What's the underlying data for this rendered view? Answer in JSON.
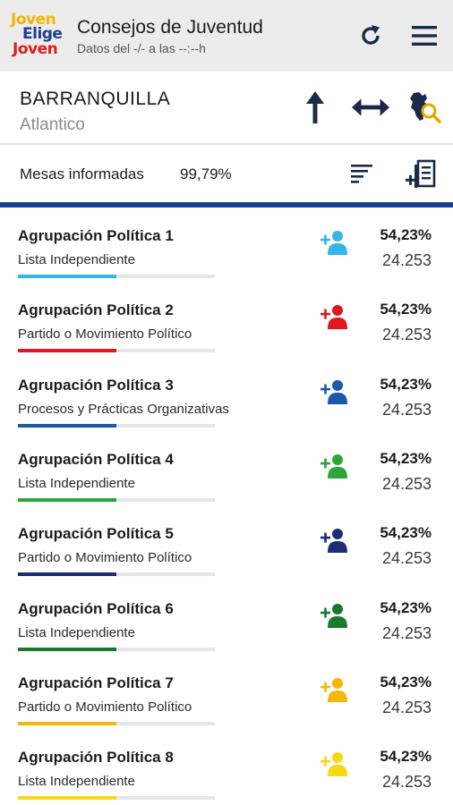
{
  "header": {
    "logo": {
      "line1": "Joven",
      "line2": "Elige",
      "line3": "Joven"
    },
    "title": "Consejos de Juventud",
    "subtitle": "Datos del -/- a las --:--h",
    "icons": [
      "refresh-icon",
      "hamburger-menu-icon"
    ]
  },
  "location": {
    "city": "BARRANQUILLA",
    "department": "Atlantico",
    "icons": [
      "arrow-up-icon",
      "horizontal-arrows-icon",
      "map-search-icon"
    ]
  },
  "stats": {
    "label": "Mesas informadas",
    "value": "99,79%",
    "icons": [
      "sort-lines-icon",
      "add-list-icon"
    ]
  },
  "colors": {
    "accent": "#1b3f93",
    "header_bg": "#ececec"
  },
  "results": [
    {
      "party": "Agrupación Política 1",
      "list_type": "Lista Independiente",
      "percent": "54,23%",
      "votes": "24.253",
      "color": "#35b6ea",
      "bar_fraction": 0.5
    },
    {
      "party": "Agrupación Política 2",
      "list_type": "Partido o Movimiento Político",
      "percent": "54,23%",
      "votes": "24.253",
      "color": "#e2171b",
      "bar_fraction": 0.5
    },
    {
      "party": "Agrupación Política 3",
      "list_type": "Procesos y Prácticas Organizativas",
      "percent": "54,23%",
      "votes": "24.253",
      "color": "#1c59a8",
      "bar_fraction": 0.5
    },
    {
      "party": "Agrupación Política 4",
      "list_type": "Lista Independiente",
      "percent": "54,23%",
      "votes": "24.253",
      "color": "#2ea538",
      "bar_fraction": 0.5
    },
    {
      "party": "Agrupación Política 5",
      "list_type": "Partido o Movimiento Político",
      "percent": "54,23%",
      "votes": "24.253",
      "color": "#1b2c78",
      "bar_fraction": 0.5
    },
    {
      "party": "Agrupación Política 6",
      "list_type": "Lista Independiente",
      "percent": "54,23%",
      "votes": "24.253",
      "color": "#187a31",
      "bar_fraction": 0.5
    },
    {
      "party": "Agrupación Política 7",
      "list_type": "Partido o Movimiento Político",
      "percent": "54,23%",
      "votes": "24.253",
      "color": "#f6b60b",
      "bar_fraction": 0.5
    },
    {
      "party": "Agrupación Política 8",
      "list_type": "Lista Independiente",
      "percent": "54,23%",
      "votes": "24.253",
      "color": "#f7d812",
      "bar_fraction": 0.5
    }
  ]
}
